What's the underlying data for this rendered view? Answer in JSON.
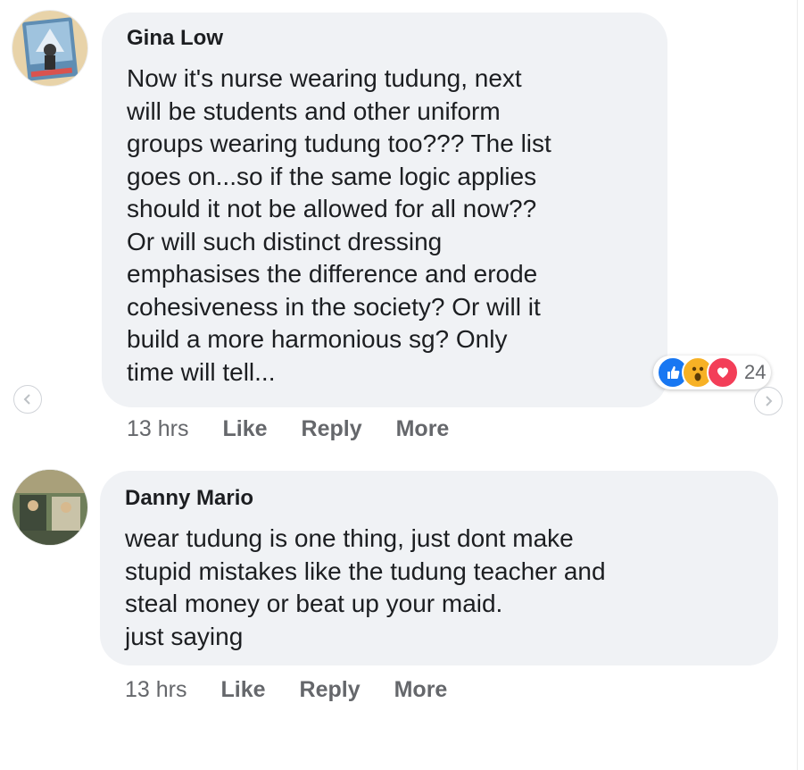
{
  "comments": [
    {
      "author": "Gina Low",
      "text": "Now it's nurse wearing tudung, next\nwill be students and other uniform\ngroups wearing tudung too??? The list\ngoes on...so if the same logic applies\nshould it not be allowed for all now??\nOr will such distinct dressing\nemphasises the difference and erode\ncohesiveness in the society? Or will it\nbuild a more harmonious sg? Only\ntime will tell...",
      "time": "13 hrs",
      "like_label": "Like",
      "reply_label": "Reply",
      "more_label": "More",
      "reactions": {
        "icons": [
          "like-icon",
          "wow-icon",
          "love-icon"
        ],
        "count": "24"
      }
    },
    {
      "author": "Danny Mario",
      "text": "wear tudung is one thing, just dont make\nstupid mistakes like the tudung teacher and\nsteal money or beat up your maid.\njust saying",
      "time": "13 hrs",
      "like_label": "Like",
      "reply_label": "Reply",
      "more_label": "More"
    }
  ],
  "colors": {
    "bubble": "#f0f2f5",
    "meta_text": "#65676b",
    "like_blue": "#1877f2",
    "love_red": "#f33e58",
    "wow_yellow": "#f7b125"
  },
  "icons": {
    "prev": "chevron-left-icon",
    "next": "chevron-right-icon"
  }
}
